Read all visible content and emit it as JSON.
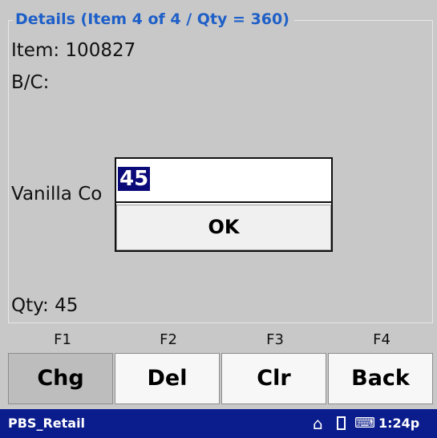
{
  "details": {
    "legend": "Details (Item 4 of 4 / Qty = 360)",
    "item_label": "Item:",
    "item_value": "100827",
    "bc_label": "B/C:",
    "bc_value": "",
    "description": "Vanilla Co",
    "qty_label": "Qty:",
    "qty_value": "45"
  },
  "dialog": {
    "input_value": "45",
    "ok_label": "OK"
  },
  "function_keys": [
    "F1",
    "F2",
    "F3",
    "F4"
  ],
  "buttons": {
    "chg": "Chg",
    "del": "Del",
    "clr": "Clr",
    "back": "Back"
  },
  "taskbar": {
    "app_name": "PBS_Retail",
    "time": "1:24p",
    "icons": [
      "home-icon",
      "battery-icon",
      "keyboard-icon"
    ]
  },
  "colors": {
    "background": "#c8c8c8",
    "legend": "#1e5fc8",
    "taskbar": "#0b1c8c",
    "selection": "#0a0a78"
  }
}
